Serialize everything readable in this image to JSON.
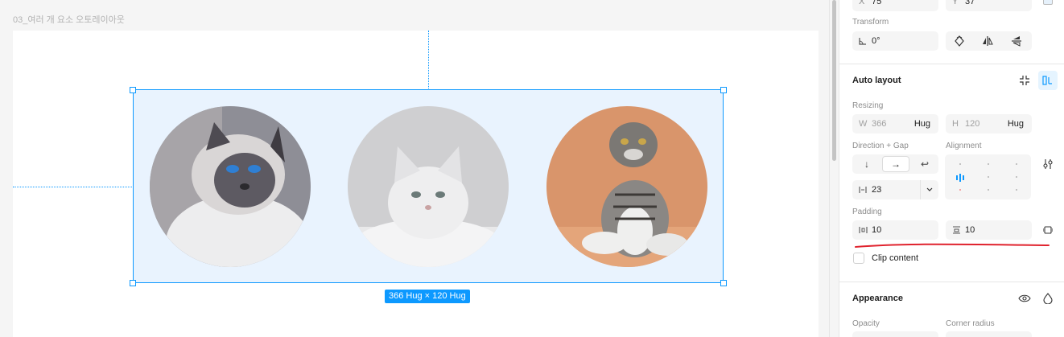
{
  "canvas": {
    "frame_name": "03_여러 개 요소 오토레이아웃",
    "selection_size_label": "366 Hug × 120 Hug",
    "images": [
      {
        "subject": "siamese-cat",
        "bg": "#9a9aa0"
      },
      {
        "subject": "white-kitten",
        "bg": "#d4d4d6"
      },
      {
        "subject": "tabby-scottish-fold",
        "bg": "#d8956a"
      }
    ]
  },
  "panel": {
    "position": {
      "x_prefix": "X",
      "x_value": "75",
      "y_prefix": "Y",
      "y_value": "37"
    },
    "transform": {
      "label": "Transform",
      "rotation_value": "0°",
      "rotation_icon": "angle-icon"
    },
    "auto_layout": {
      "heading": "Auto layout",
      "resizing_label": "Resizing",
      "width": {
        "prefix": "W",
        "value": "366",
        "mode": "Hug"
      },
      "height": {
        "prefix": "H",
        "value": "120",
        "mode": "Hug"
      },
      "direction_label": "Direction + Gap",
      "alignment_label": "Alignment",
      "direction_options": [
        "↓",
        "→",
        "↩"
      ],
      "direction_selected": "→",
      "gap_value": "23",
      "padding_label": "Padding",
      "padding_horizontal": "10",
      "padding_vertical": "10",
      "clip_content_label": "Clip content",
      "clip_content_checked": false
    },
    "appearance": {
      "heading": "Appearance",
      "opacity_label": "Opacity",
      "corner_radius_label": "Corner radius"
    },
    "accent_color": "#0d99ff",
    "annotation_color": "#e0232e"
  }
}
